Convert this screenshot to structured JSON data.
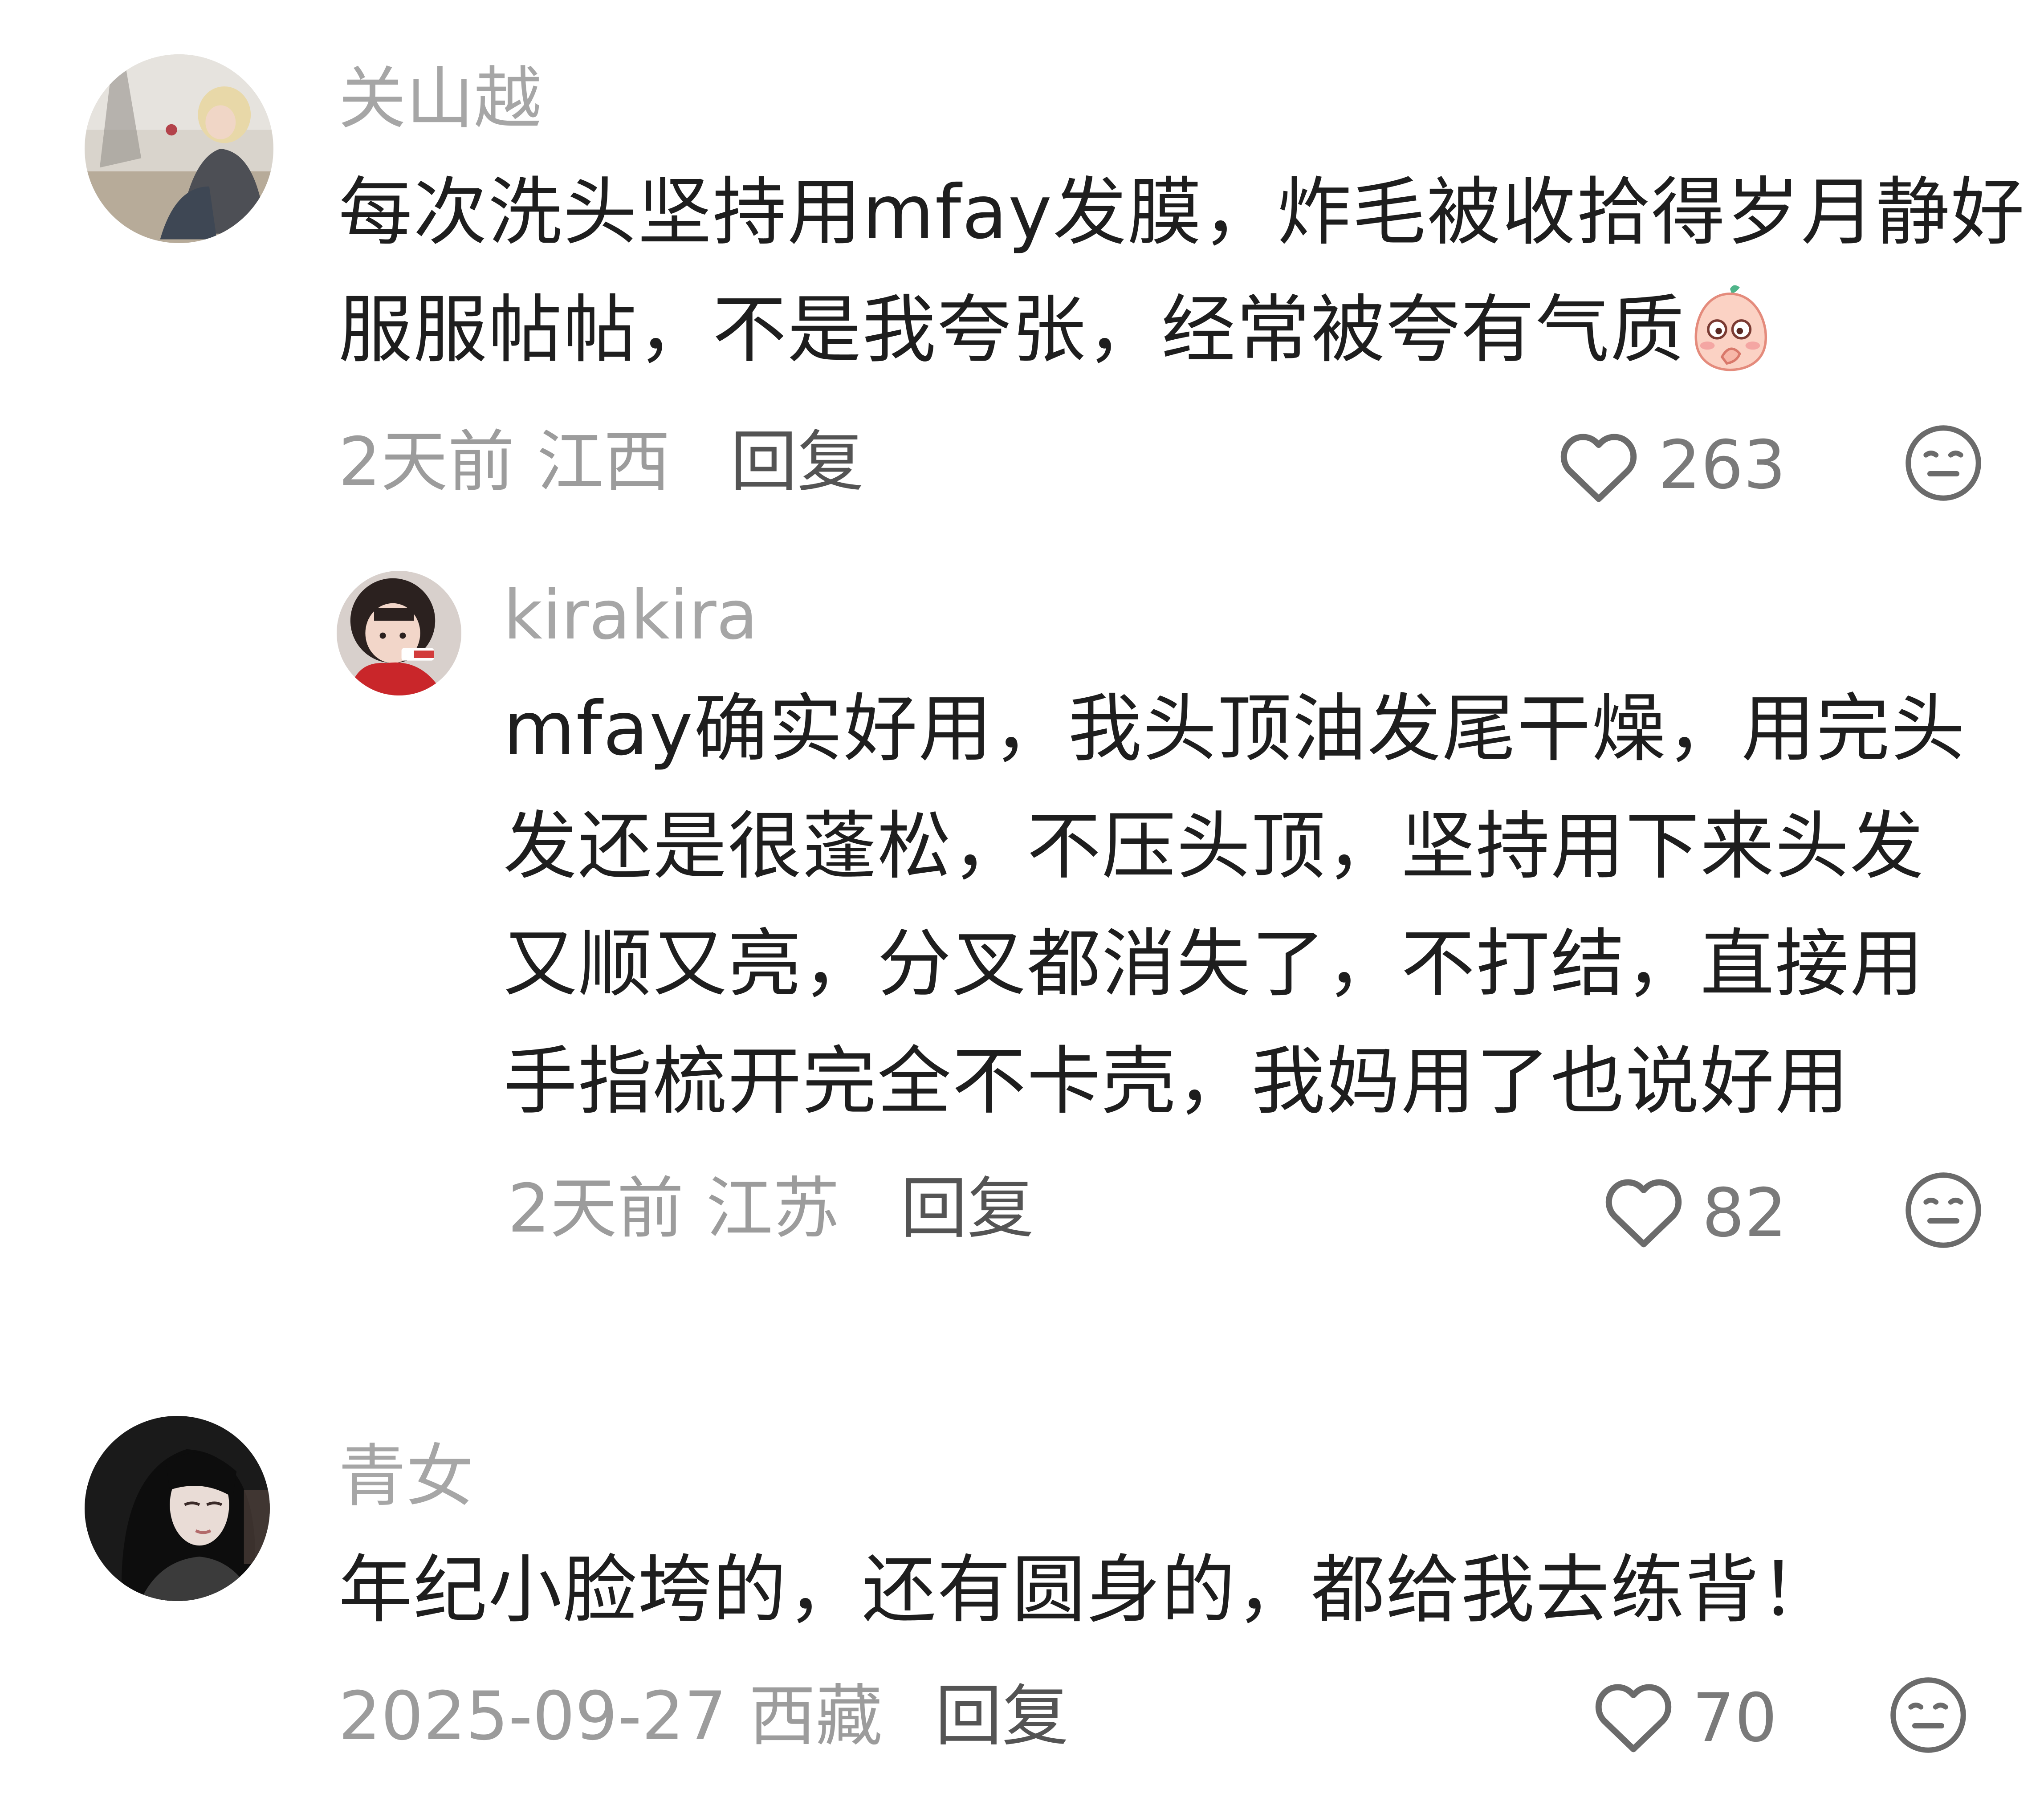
{
  "comments": [
    {
      "username": "关山越",
      "text_lines": [
        "每次洗头坚持用mfay发膜，炸毛被收拾得岁月静好",
        "服服帖帖，不是我夸张，经常被夸有气质"
      ],
      "inline_emoji": "shy-peach-emoji",
      "time": "2天前",
      "location": "江西",
      "reply_label": "回复",
      "likes": "263",
      "avatar": "user-photo"
    },
    {
      "username": "kirakira",
      "text_lines": [
        "mfay确实好用，我头顶油发尾干燥，用完头",
        "发还是很蓬松，不压头顶，坚持用下来头发",
        "又顺又亮，分叉都消失了，不打结，直接用",
        "手指梳开完全不卡壳，我妈用了也说好用"
      ],
      "time": "2天前",
      "location": "江苏",
      "reply_label": "回复",
      "likes": "82",
      "avatar": "user-photo",
      "is_reply": true
    },
    {
      "username": "青女",
      "text_lines": [
        "年纪小脸垮的，还有圆身的，都给我去练背！"
      ],
      "time": "2025-09-27",
      "location": "西藏",
      "reply_label": "回复",
      "likes": "70",
      "avatar": "user-photo"
    }
  ],
  "icons": {
    "like": "heart-outline-icon",
    "dislike": "neutral-face-icon"
  },
  "colors": {
    "username": "#a6a6a6",
    "text": "#1e1e1e",
    "meta": "#9c9c9c",
    "reply": "#545454",
    "icon": "#6b6b6b"
  }
}
